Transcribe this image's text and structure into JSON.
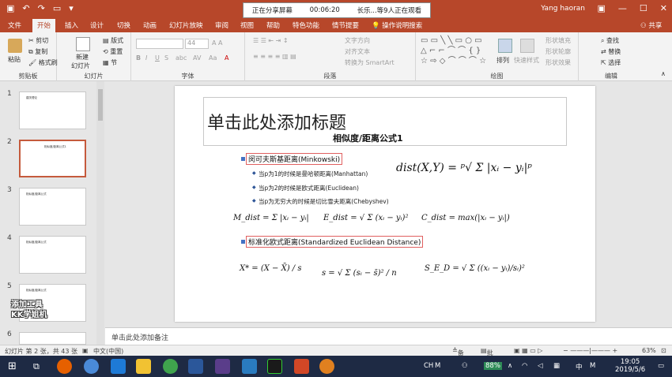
{
  "window": {
    "user": "Yang haoran",
    "share_banner": {
      "status": "正在分享屏幕",
      "timer": "00:06:20",
      "viewers": "长乐...等9人正在观看"
    }
  },
  "tabs": [
    "文件",
    "开始",
    "插入",
    "设计",
    "切换",
    "动画",
    "幻灯片放映",
    "审阅",
    "视图",
    "帮助",
    "特色功能",
    "情节提要",
    "操作说明搜索",
    "共享"
  ],
  "ribbon": {
    "clipboard": {
      "paste": "粘贴",
      "cut": "剪切",
      "copy": "复制",
      "format_painter": "格式刷",
      "label": "剪贴板"
    },
    "slides": {
      "new_slide": "新建",
      "new_slide2": "幻灯片",
      "layout": "版式",
      "reset": "重置",
      "section": "节",
      "label": "幻灯片"
    },
    "font": {
      "size": "44",
      "label": "字体"
    },
    "paragraph": {
      "text_direction": "文字方向",
      "align_text": "对齐文本",
      "smartart": "转换为 SmartArt",
      "label": "段落"
    },
    "drawing": {
      "arrange": "排列",
      "quick_styles": "快速样式",
      "shape_fill": "形状填充",
      "shape_outline": "形状轮廓",
      "shape_effects": "形状效果",
      "label": "绘图"
    },
    "editing": {
      "find": "查找",
      "replace": "替换",
      "select": "选择",
      "label": "编辑"
    }
  },
  "thumbnails": [
    {
      "num": "1",
      "text": "建关理论"
    },
    {
      "num": "2",
      "text": "相似度/距离公式1"
    },
    {
      "num": "3",
      "text": "相似度/距离公式"
    },
    {
      "num": "4",
      "text": "相似度/距离公式"
    },
    {
      "num": "5",
      "text": "相似度/距离公式"
    },
    {
      "num": "6",
      "text": ""
    }
  ],
  "watermark": {
    "line1": "添加工具",
    "line2": "KK学姐机"
  },
  "slide": {
    "title": "单击此处添加标题",
    "subtitle": "相似度/距离公式1",
    "bullet1": "闵可夫斯基距离(Minkowski)",
    "sub1": "当p为1的时候是曼哈顿距离(Manhattan)",
    "sub2": "当p为2的时候是欧式距离(Euclidean)",
    "sub3": "当p为无穷大的时候是切比雪夫距离(Chebyshev)",
    "bullet2": "标准化欧式距离(Standardized Euclidean Distance)",
    "f_dist": "dist(X,Y) = ᵖ√ Σ |xᵢ − yᵢ|ᵖ",
    "f_m": "M_dist = Σ |xᵢ − yᵢ|",
    "f_e": "E_dist = √ Σ (xᵢ − yᵢ)²",
    "f_c": "C_dist = max(|xᵢ − yᵢ|)",
    "f_x": "X* = (X − X̄) / s",
    "f_s": "s = √ Σ (sᵢ − s̄)² / n",
    "f_sed": "S_E_D = √ Σ ((xᵢ − yᵢ)/sᵢ)²"
  },
  "notes": "单击此处添加备注",
  "status": {
    "slide_info": "幻灯片 第 2 张，共 43 张",
    "language": "中文(中国)",
    "notes_btn": "备注",
    "comments_btn": "批注",
    "zoom": "63%"
  },
  "taskbar": {
    "ime": "CH",
    "battery": "88%",
    "lang": "中",
    "time": "19:05",
    "date": "2019/5/6"
  }
}
